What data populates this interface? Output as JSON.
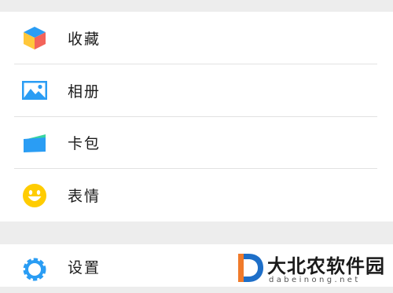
{
  "menu_group_1": [
    {
      "label": "收藏",
      "icon": "cube-icon"
    },
    {
      "label": "相册",
      "icon": "image-icon"
    },
    {
      "label": "卡包",
      "icon": "wallet-icon"
    },
    {
      "label": "表情",
      "icon": "smiley-icon"
    }
  ],
  "menu_group_2": [
    {
      "label": "设置",
      "icon": "gear-icon"
    }
  ],
  "watermark": {
    "title": "大北农软件园",
    "domain": "dabeinong.net"
  },
  "colors": {
    "icon_blue": "#2a9df4",
    "cube_yellow": "#ffc73a",
    "cube_red": "#f3645a",
    "smiley_yellow": "#ffcc00",
    "watermark_orange": "#f07a2a",
    "watermark_blue": "#1e6fc8"
  }
}
